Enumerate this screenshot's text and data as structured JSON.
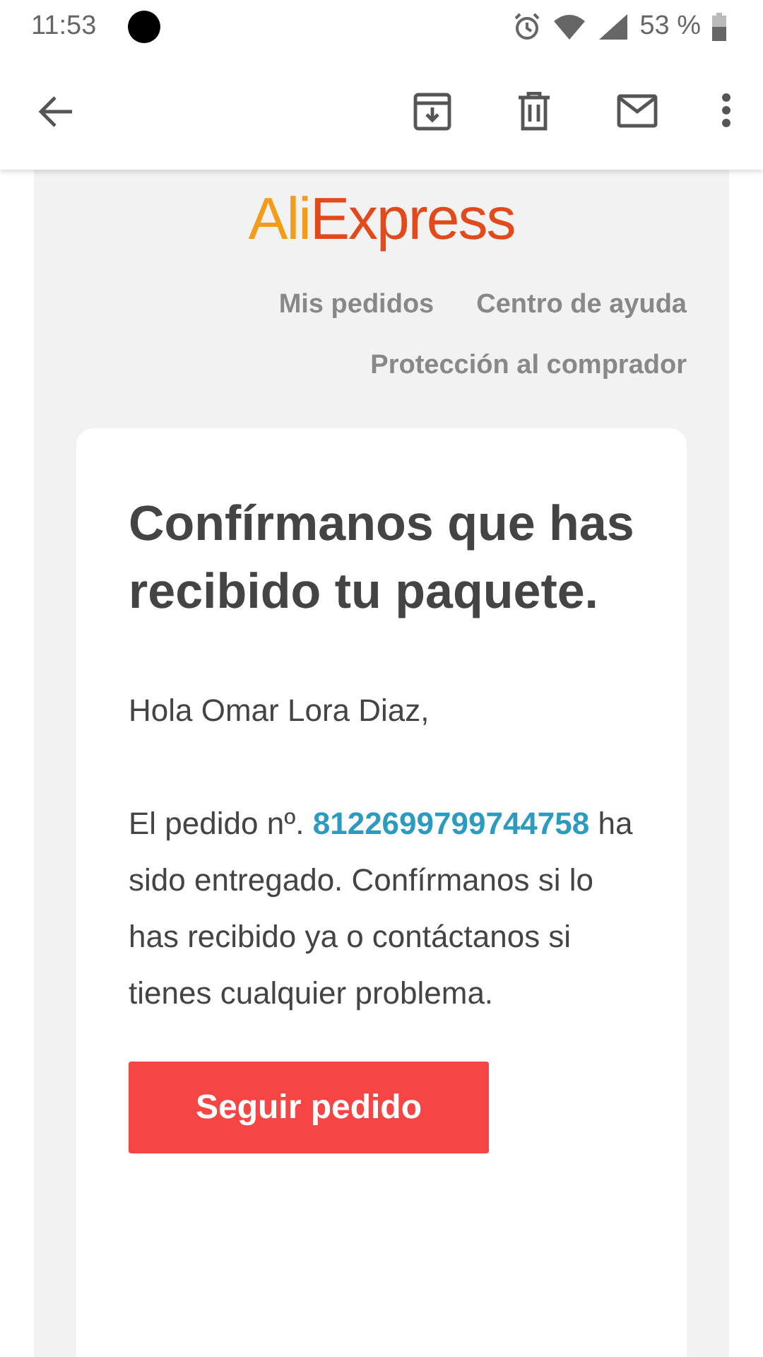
{
  "status_bar": {
    "time": "11:53",
    "battery": "53 %"
  },
  "email": {
    "logo": [
      "Ali",
      "Express"
    ],
    "nav_links": [
      {
        "label": "Mis pedidos"
      },
      {
        "label": "Centro de ayuda"
      },
      {
        "label": "Protección al comprador"
      }
    ],
    "heading": "Confírmanos que has recibido tu paquete.",
    "greeting": "Hola Omar Lora Diaz,",
    "message": {
      "before": "El pedido nº.",
      "order_number": "8122699799744758",
      "after": "ha sido entregado. Confírmanos si lo has recibido ya o contáctanos si tienes cualquier problema."
    },
    "button": "Seguir pedido"
  }
}
